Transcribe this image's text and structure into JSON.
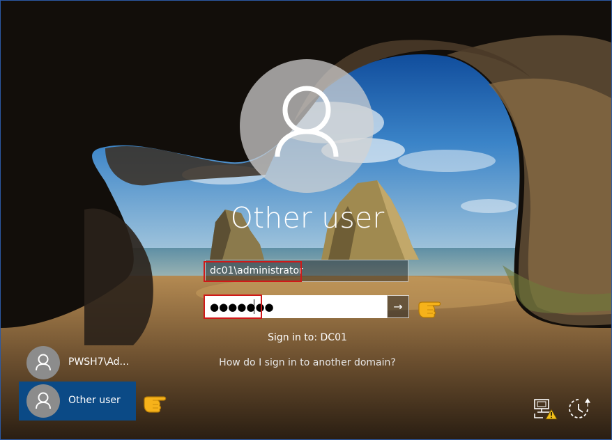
{
  "login": {
    "display_name": "Other user",
    "username_value": "dc01\\administrator",
    "password_value": "●●●●●●●",
    "submit_glyph": "→",
    "sign_in_to": "Sign in to: DC01",
    "domain_help": "How do I sign in to another domain?"
  },
  "users": [
    {
      "label": "PWSH7\\Ad...",
      "selected": false
    },
    {
      "label": "Other user",
      "selected": true
    }
  ],
  "icons": {
    "avatar": "person-icon",
    "submit": "arrow-right-icon",
    "pointer": "pointing-hand-icon",
    "network": "network-warning-icon",
    "power": "ease-of-access-icon"
  },
  "colors": {
    "selected_tile": "#0b4a86",
    "highlight": "#d01818",
    "accent_border": "#2b5aa6"
  }
}
